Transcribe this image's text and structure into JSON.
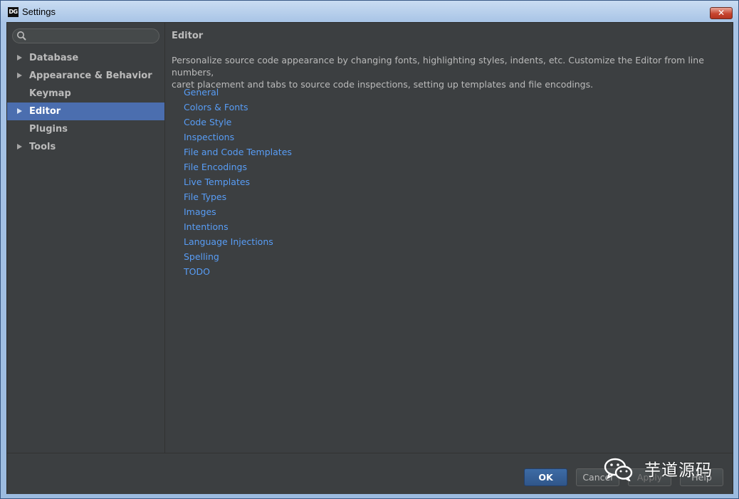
{
  "window": {
    "title": "Settings",
    "app_icon_text": "DG",
    "close_glyph": "✕"
  },
  "sidebar": {
    "search": {
      "value": "",
      "placeholder": ""
    },
    "items": [
      {
        "label": "Database",
        "expandable": true,
        "selected": false
      },
      {
        "label": "Appearance & Behavior",
        "expandable": true,
        "selected": false
      },
      {
        "label": "Keymap",
        "expandable": false,
        "selected": false
      },
      {
        "label": "Editor",
        "expandable": true,
        "selected": true
      },
      {
        "label": "Plugins",
        "expandable": false,
        "selected": false
      },
      {
        "label": "Tools",
        "expandable": true,
        "selected": false
      }
    ]
  },
  "main": {
    "title": "Editor",
    "description_line1": "Personalize source code appearance by changing fonts, highlighting styles, indents, etc. Customize the Editor from line numbers,",
    "description_line2": "caret placement and tabs to source code inspections, setting up templates and file encodings.",
    "links": [
      "General",
      "Colors & Fonts",
      "Code Style",
      "Inspections",
      "File and Code Templates",
      "File Encodings",
      "Live Templates",
      "File Types",
      "Images",
      "Intentions",
      "Language Injections",
      "Spelling",
      "TODO"
    ]
  },
  "footer": {
    "ok_label": "OK",
    "cancel_label": "Cancel",
    "apply_label": "Apply",
    "help_label": "Help"
  },
  "watermark": {
    "text": "芋道源码"
  },
  "colors": {
    "panel": "#3c3f41",
    "selection": "#4b6eaf",
    "link": "#589df6",
    "text": "#bbbbbb"
  }
}
